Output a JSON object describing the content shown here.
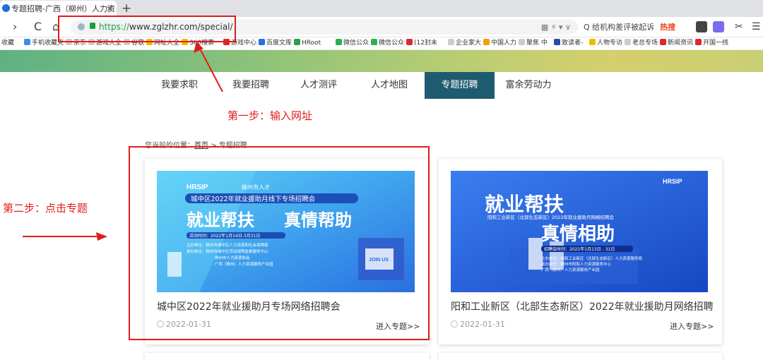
{
  "browser": {
    "tab_title": "专题招聘-广西（柳州）人力资",
    "tab_close": "×",
    "new_tab": "+",
    "nav_back": "›",
    "nav_reload": "C",
    "nav_home": "⌂",
    "url_proto": "https://",
    "url_rest": "www.zglzhr.com/special/",
    "addr_right": "▦  ⚡ ▾  ∨",
    "search_text": "Q  给机构差评被起诉",
    "search_hot": "热搜",
    "menu_icon": "☰"
  },
  "bookmarks": [
    {
      "label": "收藏",
      "color": "#ffffff"
    },
    {
      "label": "手机收藏夹",
      "color": "#3a8ee6"
    },
    {
      "label": "京东",
      "color": "#cccccc"
    },
    {
      "label": "游戏大全",
      "color": "#cccccc"
    },
    {
      "label": "谷歌",
      "color": "#cccccc"
    },
    {
      "label": "网址大全",
      "color": "#e8c000"
    },
    {
      "label": "360搜索",
      "color": "#e8c000"
    },
    {
      "label": "游戏中心",
      "color": "#d82c2c"
    },
    {
      "label": "百度文库",
      "color": "#2b6de0"
    },
    {
      "label": "HRoot",
      "color": "#2b9e4a"
    },
    {
      "label": "微信公众",
      "color": "#2bb24c"
    },
    {
      "label": "微信公众",
      "color": "#2bb24c"
    },
    {
      "label": "(12封未",
      "color": "#d82c2c"
    },
    {
      "label": "企业家大",
      "color": "#cccccc"
    },
    {
      "label": "中国人力",
      "color": "#f2a100"
    },
    {
      "label": "聚焦 中",
      "color": "#cccccc"
    },
    {
      "label": "致读者-",
      "color": "#1f4ea3"
    },
    {
      "label": "人物专访",
      "color": "#e8c000"
    },
    {
      "label": "老总专场",
      "color": "#cccccc"
    },
    {
      "label": "新闻资讯",
      "color": "#d82c2c"
    },
    {
      "label": "开国一线",
      "color": "#d82c2c"
    }
  ],
  "nav": {
    "items": [
      "我要求职",
      "我要招聘",
      "人才测评",
      "人才地图",
      "专题招聘",
      "富余劳动力"
    ],
    "active_index": 4,
    "active_color": "#1f5b70"
  },
  "breadcrumb": {
    "prefix": "您当前的位置：",
    "home": "首页",
    "sep": " > ",
    "current": "专题招聘"
  },
  "cards": [
    {
      "title": "城中区2022年就业援助月专场网络招聘会",
      "date": "2022-01-31",
      "enter": "进入专题>>",
      "poster": {
        "brand": "HRSIP",
        "brand2": "柳州市人才",
        "event": "城中区2022年就业援助月线下专场招聘会",
        "slogan1": "就业帮扶",
        "slogan2": "真情帮助",
        "date_line": "活动时间：2022年1月14日-3月31日",
        "org1": "主办单位：柳州市城中区人力资源和社会保障局",
        "org2": "承办单位：柳州市城中区劳动保障监察服务中心",
        "org3": "柳州市人力资源协会",
        "org4": "广西（柳州）人力资源服务产业园",
        "join": "JOIN US"
      }
    },
    {
      "title": "阳和工业新区（北部生态新区）2022年就业援助月网络招聘",
      "date": "2022-01-31",
      "enter": "进入专题>>",
      "poster": {
        "brand": "HRSIP",
        "slogan1": "就业帮扶",
        "event": "阳和工业新区（北部生态新区）2022年就业援助月网络招聘会",
        "slogan2": "真情相助",
        "date_line": "招聘会时间：2021年1月13日 - 31日",
        "org1": "主办单位：阳和工业新区（北部生态新区）人力资源服务局",
        "org2": "承办单位：柳州市阳和人力资源服务中心",
        "org3": "广西（柳州）人力资源服务产业园"
      }
    }
  ],
  "annotations": {
    "step1": "第一步：输入网址",
    "step2": "第二步：点击专题",
    "color": "#e21b1b"
  }
}
